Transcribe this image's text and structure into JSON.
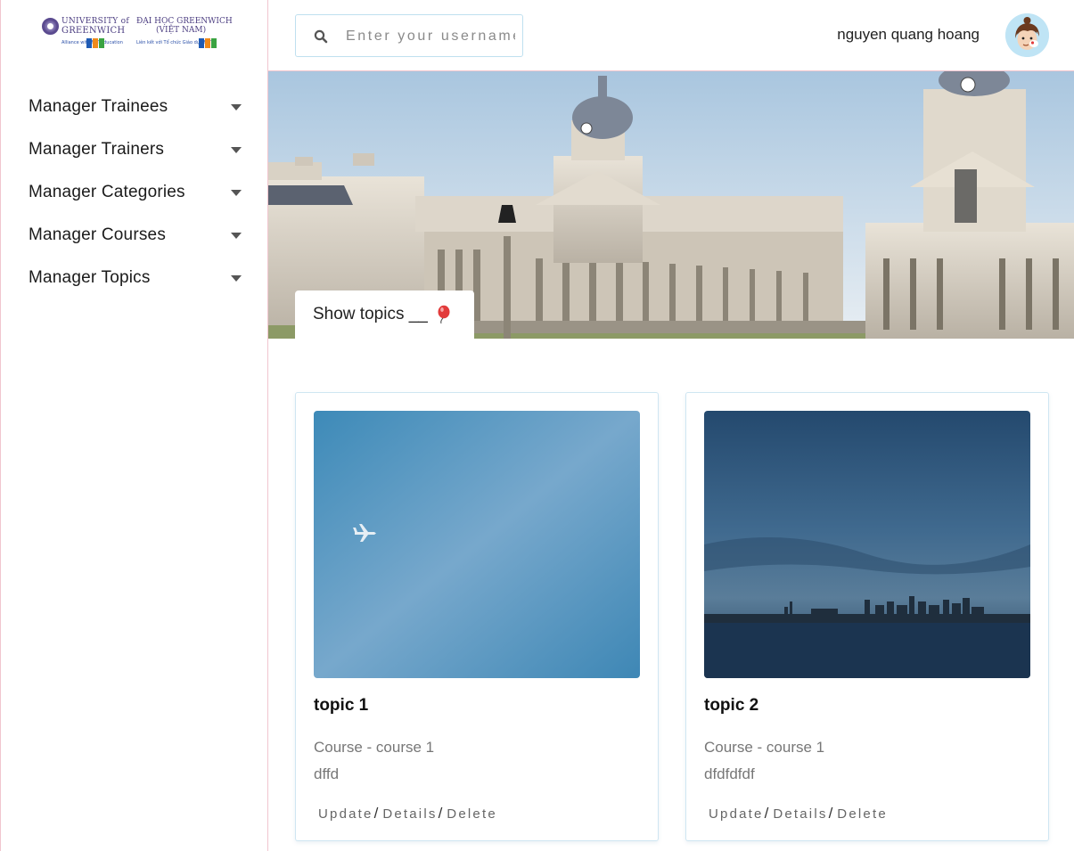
{
  "logos": {
    "university": {
      "line1": "UNIVERSITY of",
      "line2": "GREENWICH",
      "tagline": "Alliance with FPT Education"
    },
    "vietnam": {
      "line1": "ĐẠI HỌC GREENWICH",
      "line2": "(VIỆT NAM)",
      "tagline": "Liên kết với Tổ chức Giáo dục FPT"
    }
  },
  "sidebar": {
    "items": [
      {
        "label": "Manager Trainees",
        "icon": "caret-down-icon"
      },
      {
        "label": "Manager Trainers",
        "icon": "caret-down-icon"
      },
      {
        "label": "Manager Categories",
        "icon": "caret-down-icon"
      },
      {
        "label": "Manager Courses",
        "icon": "caret-down-icon"
      },
      {
        "label": "Manager Topics",
        "icon": "caret-down-icon"
      }
    ]
  },
  "header": {
    "search": {
      "placeholder": "Enter your username",
      "icon": "search-icon"
    },
    "username": "nguyen quang hoang",
    "avatar": "avatar-icon"
  },
  "banner": {
    "section_label": "Show topics __",
    "icon": "balloon-icon"
  },
  "topics": [
    {
      "title": "topic 1",
      "course": "Course - course 1",
      "description": "dffd",
      "actions": {
        "update": "Update",
        "details": "Details",
        "delete": "Delete",
        "separator": "/"
      }
    },
    {
      "title": "topic 2",
      "course": "Course - course 1",
      "description": "dfdfdfdf",
      "actions": {
        "update": "Update",
        "details": "Details",
        "delete": "Delete",
        "separator": "/"
      }
    }
  ],
  "colors": {
    "accent_border": "#cfe6f2",
    "divider": "#f1c6cf",
    "balloon": "#e23b3b"
  }
}
